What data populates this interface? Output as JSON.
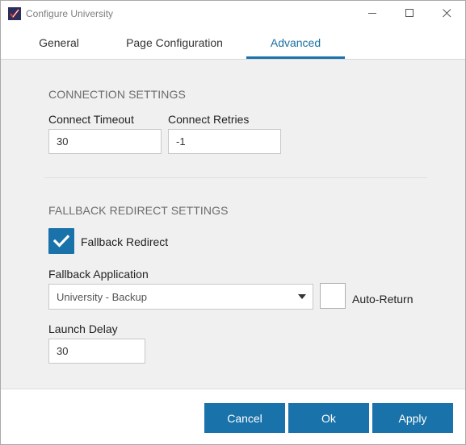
{
  "window": {
    "title": "Configure University",
    "icons": {
      "app": "app-logo-icon",
      "minimize": "minimize-icon",
      "maximize": "maximize-icon",
      "close": "close-icon"
    }
  },
  "tabs": [
    {
      "label": "General",
      "active": false
    },
    {
      "label": "Page Configuration",
      "active": false
    },
    {
      "label": "Advanced",
      "active": true
    }
  ],
  "connection": {
    "section_title": "CONNECTION SETTINGS",
    "timeout_label": "Connect Timeout",
    "timeout_value": "30",
    "retries_label": "Connect Retries",
    "retries_value": "-1"
  },
  "fallback": {
    "section_title": "FALLBACK REDIRECT SETTINGS",
    "redirect_label": "Fallback Redirect",
    "redirect_checked": true,
    "application_label": "Fallback Application",
    "application_value": "University - Backup",
    "auto_return_label": "Auto-Return",
    "auto_return_checked": false,
    "launch_delay_label": "Launch Delay",
    "launch_delay_value": "30"
  },
  "footer": {
    "cancel_label": "Cancel",
    "ok_label": "Ok",
    "apply_label": "Apply"
  },
  "colors": {
    "accent": "#1a72aa",
    "content_bg": "#f0f0f0",
    "section_title": "#6b6b6b"
  }
}
